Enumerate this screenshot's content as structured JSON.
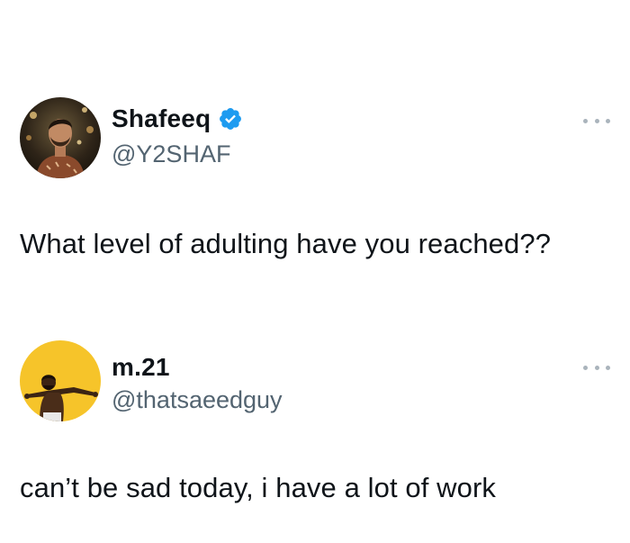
{
  "tweets": [
    {
      "display_name": "Shafeeq",
      "handle": "@Y2SHAF",
      "text": "What level of adulting have you reached??",
      "verified": true,
      "avatar_icon": "user-photo-icon"
    },
    {
      "display_name": "m.21",
      "handle": "@thatsaeedguy",
      "text": "can’t be sad today, i have a lot of work",
      "verified": false,
      "avatar_icon": "user-photo-icon"
    }
  ],
  "colors": {
    "text_primary": "#0f1419",
    "text_secondary": "#536471",
    "verified_blue": "#1d9bf0",
    "avatar2_bg": "#f6c42a"
  }
}
